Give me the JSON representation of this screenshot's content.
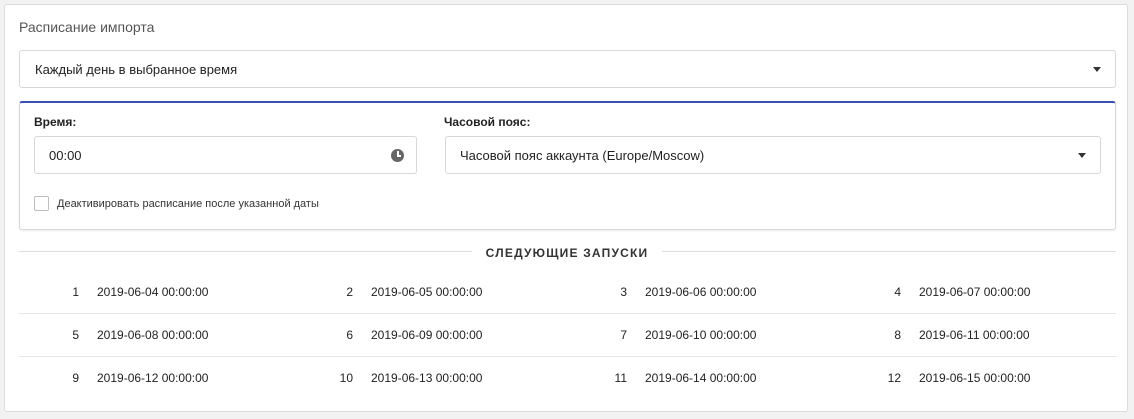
{
  "section_title": "Расписание импорта",
  "schedule_select": {
    "value": "Каждый день в выбранное время"
  },
  "time": {
    "label": "Время:",
    "value": "00:00"
  },
  "timezone": {
    "label": "Часовой пояс:",
    "value": "Часовой пояс аккаунта (Europe/Moscow)"
  },
  "deactivate": {
    "label": "Деактивировать расписание после указанной даты",
    "checked": false
  },
  "next_runs": {
    "title": "СЛЕДУЮЩИЕ ЗАПУСКИ",
    "rows": [
      [
        {
          "num": "1",
          "date": "2019-06-04 00:00:00"
        },
        {
          "num": "2",
          "date": "2019-06-05 00:00:00"
        },
        {
          "num": "3",
          "date": "2019-06-06 00:00:00"
        },
        {
          "num": "4",
          "date": "2019-06-07 00:00:00"
        }
      ],
      [
        {
          "num": "5",
          "date": "2019-06-08 00:00:00"
        },
        {
          "num": "6",
          "date": "2019-06-09 00:00:00"
        },
        {
          "num": "7",
          "date": "2019-06-10 00:00:00"
        },
        {
          "num": "8",
          "date": "2019-06-11 00:00:00"
        }
      ],
      [
        {
          "num": "9",
          "date": "2019-06-12 00:00:00"
        },
        {
          "num": "10",
          "date": "2019-06-13 00:00:00"
        },
        {
          "num": "11",
          "date": "2019-06-14 00:00:00"
        },
        {
          "num": "12",
          "date": "2019-06-15 00:00:00"
        }
      ]
    ]
  },
  "colors": {
    "accent": "#3a50b9"
  },
  "icons": {
    "time": "clock-icon",
    "select": "chevron-down-icon"
  }
}
